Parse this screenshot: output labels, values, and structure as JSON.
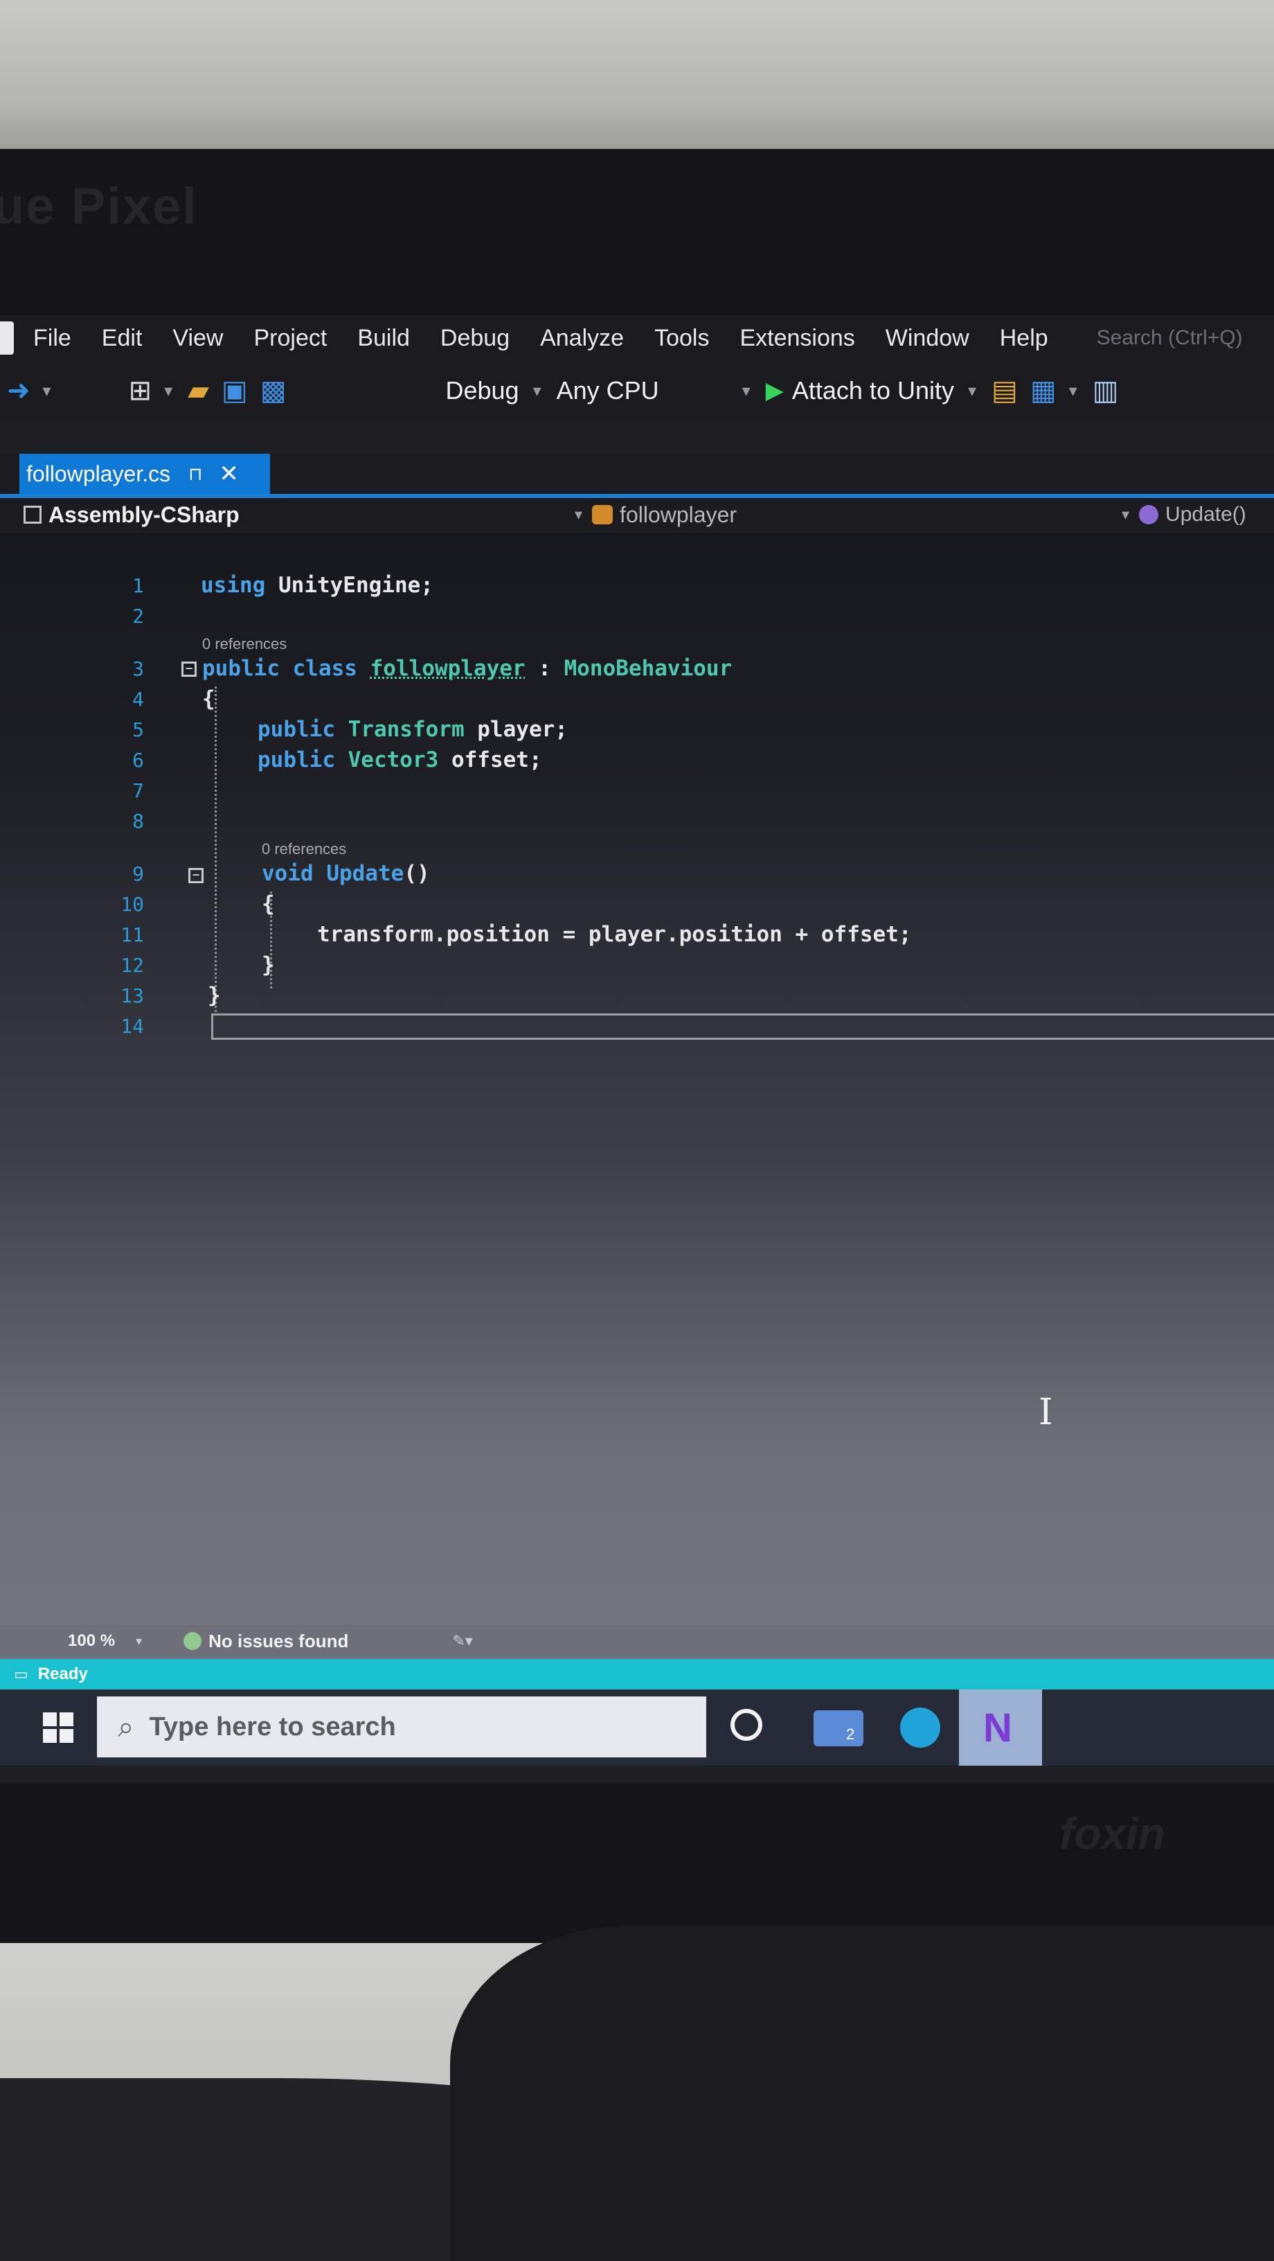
{
  "brand": {
    "top_text": "ue Pixel",
    "bottom_text": "foxin"
  },
  "menubar": {
    "items": [
      "File",
      "Edit",
      "View",
      "Project",
      "Build",
      "Debug",
      "Analyze",
      "Tools",
      "Extensions",
      "Window",
      "Help"
    ],
    "search_placeholder": "Search (Ctrl+Q)"
  },
  "toolbar": {
    "configuration": "Debug",
    "platform": "Any CPU",
    "attach_label": "Attach to Unity"
  },
  "tab": {
    "filename": "followplayer.cs",
    "pin": "⊓",
    "close": "✕"
  },
  "navbar": {
    "project": "Assembly-CSharp",
    "class": "followplayer",
    "member": "Update()"
  },
  "editor": {
    "line_numbers": [
      "1",
      "2",
      "3",
      "4",
      "5",
      "6",
      "7",
      "8",
      "9",
      "10",
      "11",
      "12",
      "13",
      "14"
    ],
    "codelens_class": "0 references",
    "codelens_method": "0 references",
    "lines": {
      "l1_kw": "using",
      "l1_rest": " UnityEngine;",
      "l3_kw1": "public",
      "l3_kw2": " class ",
      "l3_name": "followplayer",
      "l3_colon": " : ",
      "l3_base": "MonoBehaviour",
      "l4": "{",
      "l5_kw": "public",
      "l5_ty": " Transform",
      "l5_rest": " player;",
      "l6_kw": "public",
      "l6_ty": " Vector3",
      "l6_rest": " offset;",
      "l9_kw": "void",
      "l9_name": " Update",
      "l9_rest": "()",
      "l10": "{",
      "l11": "transform.position = player.position + offset;",
      "l12": "}",
      "l13": "}"
    }
  },
  "status_row": {
    "zoom": "100 %",
    "issues": "No issues found"
  },
  "statusbar": {
    "text": "Ready"
  },
  "taskbar": {
    "search_placeholder": "Type here to search",
    "view_badge": "2"
  },
  "colors": {
    "accent": "#0f78d4",
    "statusbar": "#19c0cf",
    "keyword": "#4aa2e8",
    "type": "#4ec9b0",
    "line_number": "#2b9bd7"
  }
}
